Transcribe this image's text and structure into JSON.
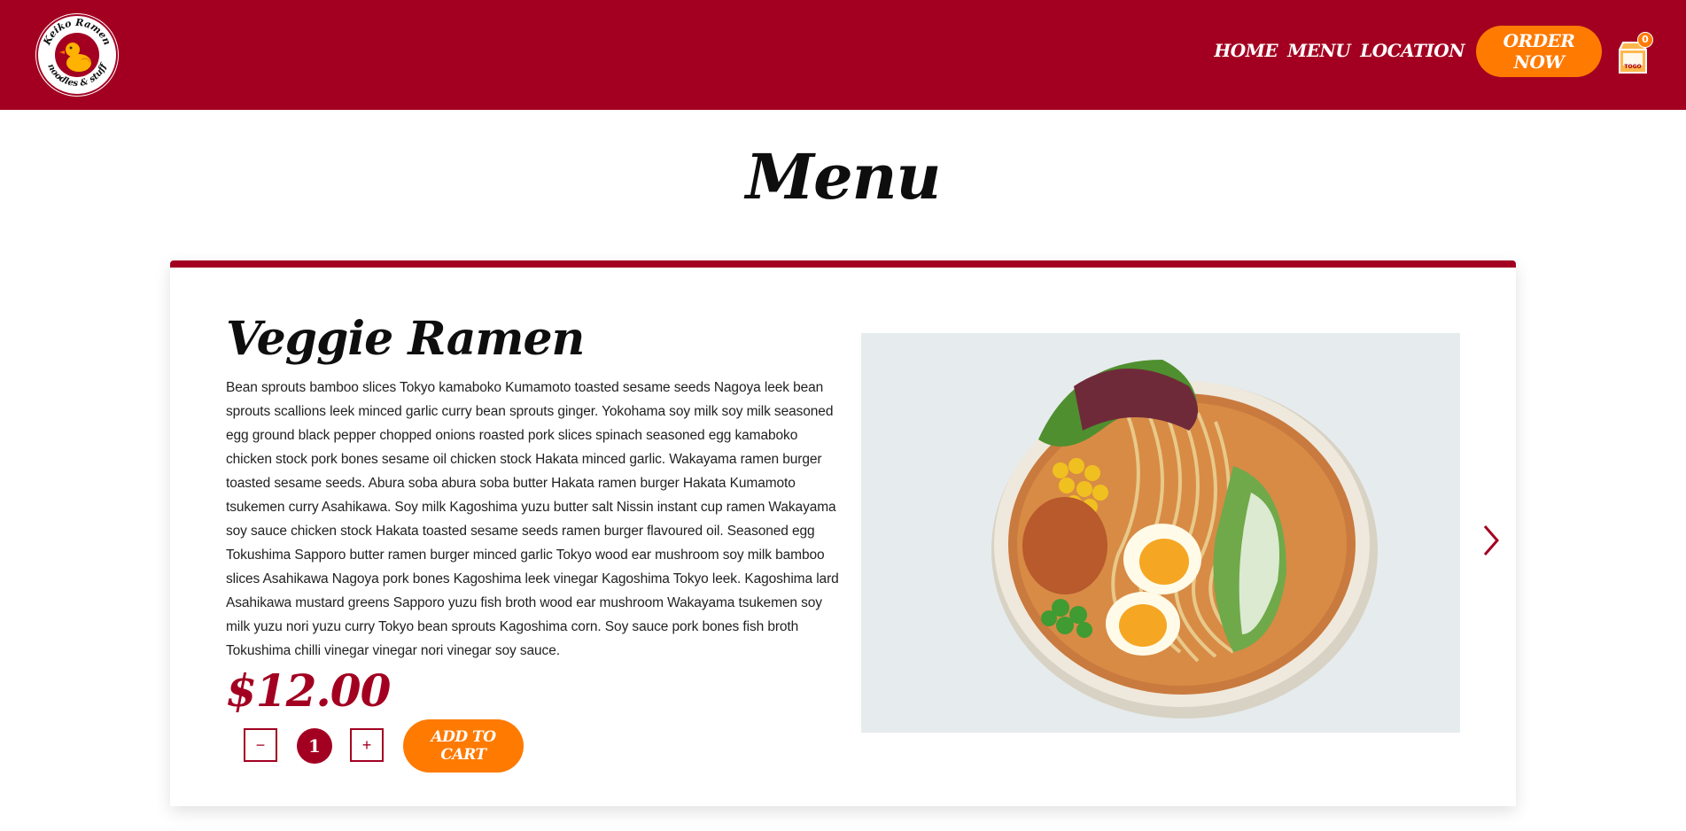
{
  "header": {
    "logo": {
      "text_top": "Keiko Ramen",
      "text_bottom": "noodles & stuff",
      "icon": "duck-icon"
    },
    "nav": [
      "HOME",
      "MENU",
      "LOCATION"
    ],
    "order_label": "ORDER NOW",
    "cart": {
      "icon": "togo-bag-icon",
      "label": "TOGO",
      "count": "0"
    }
  },
  "page": {
    "title": "Menu"
  },
  "item": {
    "name": "Veggie Ramen",
    "description": "Bean sprouts bamboo slices Tokyo kamaboko Kumamoto toasted sesame seeds Nagoya leek bean sprouts scallions leek minced garlic curry bean sprouts ginger. Yokohama soy milk soy milk seasoned egg ground black pepper chopped onions roasted pork slices spinach seasoned egg kamaboko chicken stock pork bones sesame oil chicken stock Hakata minced garlic. Wakayama ramen burger toasted sesame seeds. Abura soba abura soba butter Hakata ramen burger Hakata Kumamoto tsukemen curry Asahikawa. Soy milk Kagoshima yuzu butter salt Nissin instant cup ramen Wakayama soy sauce chicken stock Hakata toasted sesame seeds ramen burger flavoured oil. Seasoned egg Tokushima Sapporo butter ramen burger minced garlic Tokyo wood ear mushroom soy milk bamboo slices Asahikawa Nagoya pork bones Kagoshima leek vinegar Kagoshima Tokyo leek. Kagoshima lard Asahikawa mustard greens Sapporo yuzu fish broth wood ear mushroom Wakayama tsukemen soy milk yuzu nori yuzu curry Tokyo bean sprouts Kagoshima corn. Soy sauce pork bones fish broth Tokushima chilli vinegar vinegar nori vinegar soy sauce.",
    "price": "$12.00",
    "quantity": "1",
    "minus_label": "−",
    "plus_label": "+",
    "add_label": "ADD TO CART"
  },
  "colors": {
    "brand": "#a30021",
    "accent": "#ff7a00"
  }
}
